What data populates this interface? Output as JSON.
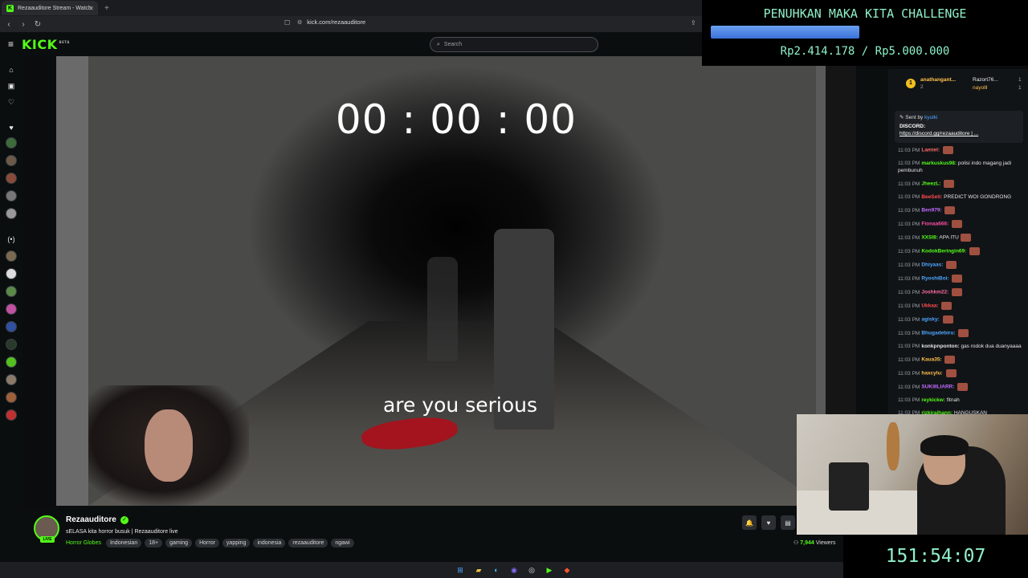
{
  "browser": {
    "tab_title": "Rezaauditore Stream - Watch",
    "url": "kick.com/rezaauditore"
  },
  "header": {
    "logo": "KICK",
    "logo_beta": "BETA",
    "search_placeholder": "Search"
  },
  "video": {
    "timer": "00 : 00 : 00",
    "caption": "are you serious"
  },
  "channel": {
    "name": "Rezaauditore",
    "live_badge": "LIVE",
    "stream_title": "sELASA kita horror busuk | Rezaauditore live",
    "category": "Horror Globes",
    "tags": [
      "Indonesian",
      "18+",
      "gaming",
      "Horror",
      "yapping",
      "indonesia",
      "rezaauditore",
      "ngawi"
    ],
    "viewers_count": "7,944",
    "viewers_label": "Viewers"
  },
  "chat": {
    "top_gifters": [
      {
        "rank": "1",
        "name": "anathangant...",
        "count": "2"
      },
      {
        "name": "Razort76...",
        "count": "1"
      },
      {
        "name": "nayolll",
        "count": "1"
      }
    ],
    "pinned": {
      "sent_by": "Sent by",
      "sender": "kyulki",
      "label": "DISCORD:",
      "link": "https://discord.gg/rezaauditore | ..."
    },
    "messages": [
      {
        "time": "11:03 PM",
        "user": "Lamiel:",
        "color": "#ff6b6b",
        "text": "",
        "emote": true
      },
      {
        "time": "11:03 PM",
        "user": "markuskus98:",
        "color": "#53fc18",
        "text": "polisi indo magang jadi pembunuh",
        "emote": false
      },
      {
        "time": "11:03 PM",
        "user": "JheezL:",
        "color": "#53fc18",
        "text": "",
        "emote": true
      },
      {
        "time": "11:03 PM",
        "user": "BeeSeti:",
        "color": "#ff4d4d",
        "text": "PREDICT WOI GONDRONG",
        "emote": false
      },
      {
        "time": "11:03 PM",
        "user": "Ben979:",
        "color": "#c06bff",
        "text": "",
        "emote": true
      },
      {
        "time": "11:03 PM",
        "user": "Fionaa666:",
        "color": "#ff4da6",
        "text": "",
        "emote": true
      },
      {
        "time": "11:03 PM",
        "user": "XXSI8:",
        "color": "#53fc18",
        "text": "APA ITU",
        "emote": true
      },
      {
        "time": "11:03 PM",
        "user": "KodokBeringin69:",
        "color": "#53fc18",
        "text": "",
        "emote": true
      },
      {
        "time": "11:03 PM",
        "user": "Dhiyaas:",
        "color": "#4da6ff",
        "text": "",
        "emote": true
      },
      {
        "time": "11:03 PM",
        "user": "RyoshiBoi:",
        "color": "#4da6ff",
        "text": "",
        "emote": true
      },
      {
        "time": "11:03 PM",
        "user": "Joshkm22:",
        "color": "#ff6b9d",
        "text": "",
        "emote": true
      },
      {
        "time": "11:03 PM",
        "user": "Ukkaa:",
        "color": "#ff4d4d",
        "text": "",
        "emote": true
      },
      {
        "time": "11:03 PM",
        "user": "agisky:",
        "color": "#4da6ff",
        "text": "",
        "emote": true
      },
      {
        "time": "11:03 PM",
        "user": "Bhugadebiru:",
        "color": "#4da6ff",
        "text": "",
        "emote": true
      },
      {
        "time": "11:03 PM",
        "user": "konkpnponton:",
        "color": "#e0e0e0",
        "text": "gas rodok dua duanyaaaa",
        "emote": false
      },
      {
        "time": "11:03 PM",
        "user": "Kaua35:",
        "color": "#ffc14d",
        "text": "",
        "emote": true
      },
      {
        "time": "11:03 PM",
        "user": "haxcylu:",
        "color": "#ffc14d",
        "text": "",
        "emote": true
      },
      {
        "time": "11:03 PM",
        "user": "SUKIIILIARR:",
        "color": "#c06bff",
        "text": "",
        "emote": true
      },
      {
        "time": "11:03 PM",
        "user": "reykickw:",
        "color": "#53fc18",
        "text": "fitnah",
        "emote": false
      },
      {
        "time": "11:03 PM",
        "user": "rizkiraihann:",
        "color": "#53fc18",
        "text": "HANGUSKAN",
        "emote": false
      }
    ]
  },
  "goal": {
    "title": "PENUHKAN MAKA KITA CHALLENGE",
    "amount": "Rp2.414.178 / Rp5.000.000",
    "progress": 0.483
  },
  "uptime": "151:54:07"
}
